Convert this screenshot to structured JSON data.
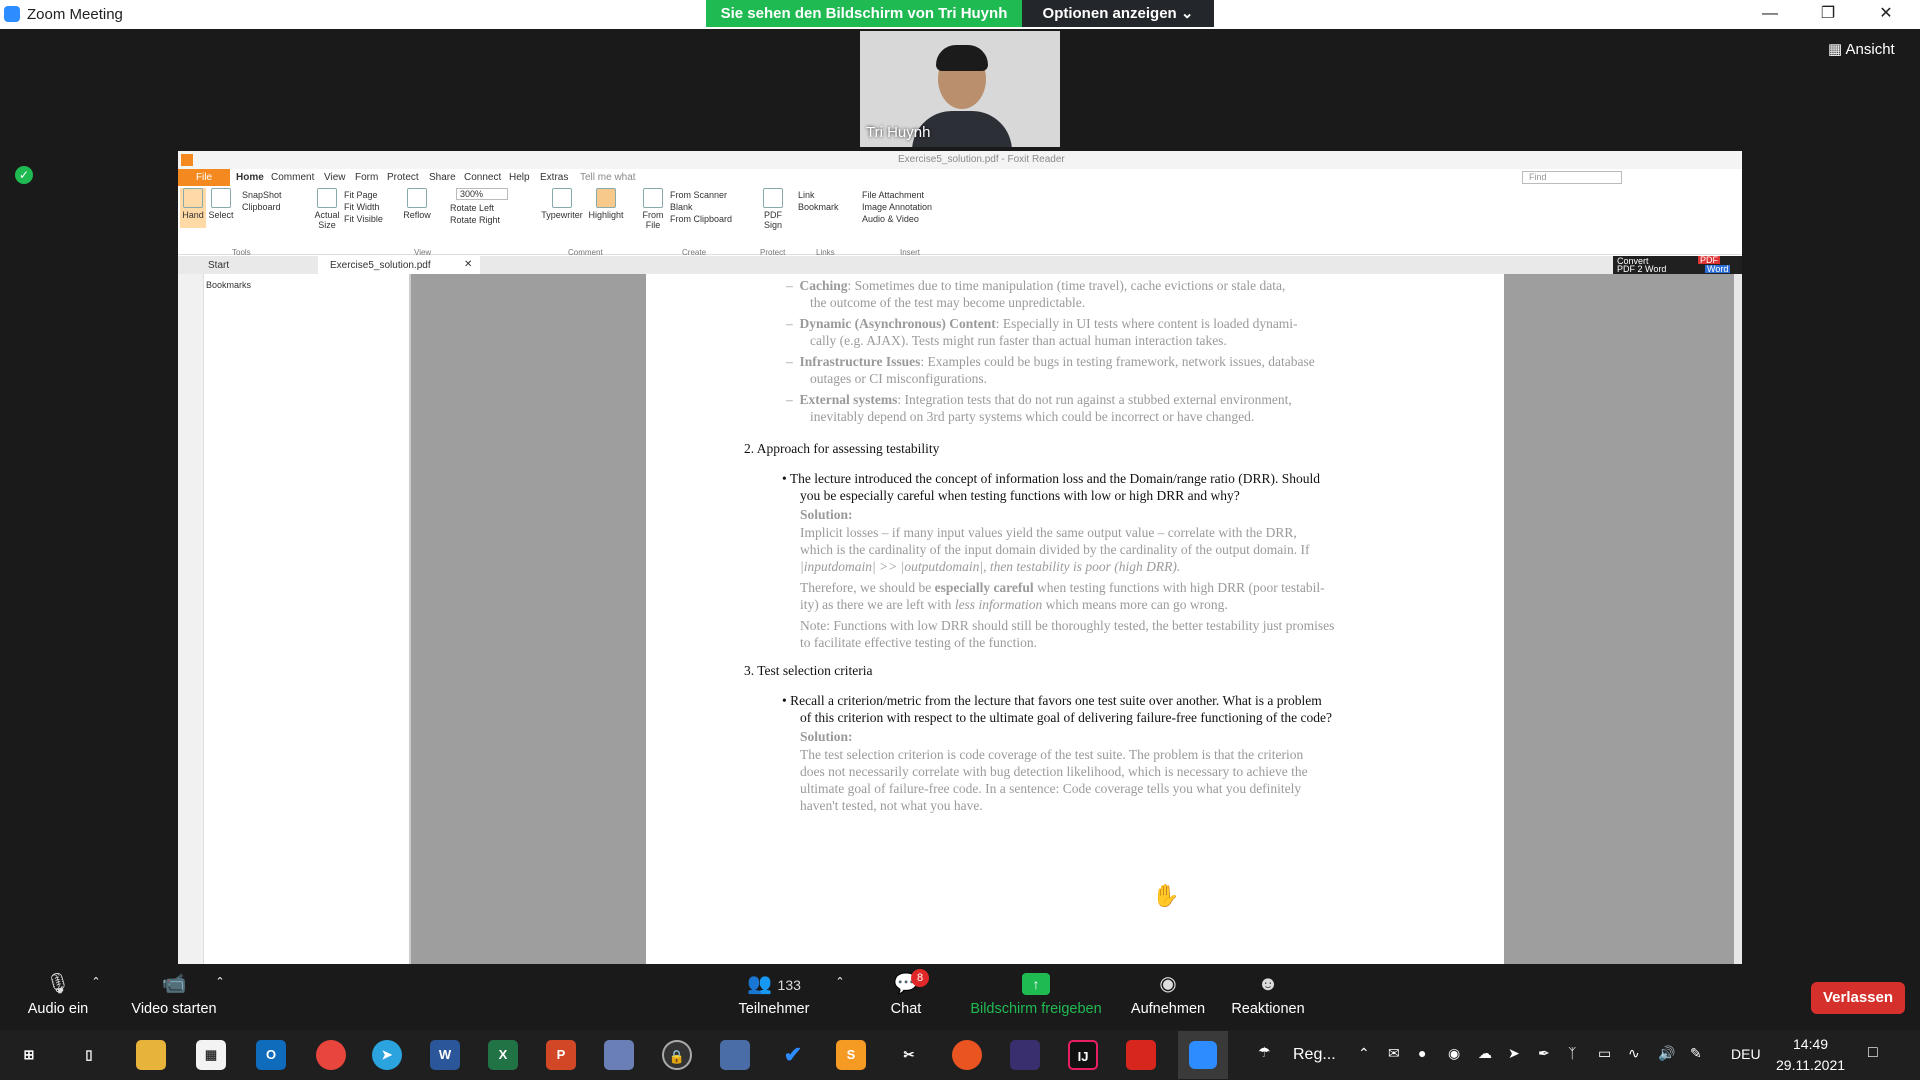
{
  "window": {
    "title": "Zoom Meeting"
  },
  "banner": {
    "viewing": "Sie sehen den Bildschirm von Tri Huynh",
    "options": "Optionen anzeigen ⌄"
  },
  "view_button": "Ansicht",
  "video": {
    "name": "Tri Huynh"
  },
  "reader": {
    "title": "Exercise5_solution.pdf - Foxit Reader",
    "menu": [
      "File",
      "Home",
      "Comment",
      "View",
      "Form",
      "Protect",
      "Share",
      "Connect",
      "Help",
      "Extras",
      "Tell me what"
    ],
    "find_placeholder": "Find",
    "ribbon": {
      "hand": "Hand",
      "select": "Select",
      "snapshot": "SnapShot",
      "clipboard": "Clipboard",
      "tools": "Tools",
      "actual_size": "Actual Size",
      "fit_page": "Fit Page",
      "fit_width": "Fit Width",
      "fit_visible": "Fit Visible",
      "reflow": "Reflow",
      "zoom": "300%",
      "rotate_left": "Rotate Left",
      "rotate_right": "Rotate Right",
      "view": "View",
      "typewriter": "Typewriter",
      "highlight": "Highlight",
      "comment": "Comment",
      "from_file": "From File",
      "from_scanner": "From Scanner",
      "blank": "Blank",
      "from_clipboard": "From Clipboard",
      "create": "Create",
      "pdf_sign": "PDF Sign",
      "protect": "Protect",
      "link": "Link",
      "bookmark": "Bookmark",
      "links": "Links",
      "file_attachment": "File Attachment",
      "image_annotation": "Image Annotation",
      "audio_video": "Audio & Video",
      "insert": "Insert"
    },
    "tabs": {
      "start": "Start",
      "doc": "Exercise5_solution.pdf"
    },
    "convert": {
      "line1": "Convert",
      "line2": "PDF 2 Word",
      "pdf": "PDF",
      "word": "Word"
    },
    "bookmarks_label": "Bookmarks"
  },
  "document": {
    "l1a": "Caching",
    "l1b": ": Sometimes due to time manipulation (time travel), cache evictions or stale data,",
    "l2": "the outcome of the test may become unpredictable.",
    "l3a": "Dynamic (Asynchronous) Content",
    "l3b": ": Especially in UI tests where content is loaded dynami-",
    "l4": "cally (e.g. AJAX). Tests might run faster than actual human interaction takes.",
    "l5a": "Infrastructure Issues",
    "l5b": ": Examples could be bugs in testing framework, network issues, database",
    "l6": "outages or CI misconfigurations.",
    "l7a": "External systems",
    "l7b": ": Integration tests that do not run against a stubbed external environment,",
    "l8": "inevitably depend on 3rd party systems which could be incorrect or have changed.",
    "s2": "2.  Approach for assessing testability",
    "q1": "•  The lecture introduced the concept of information loss and the Domain/range ratio (DRR). Should",
    "q2": "you be especially careful when testing functions with low or high DRR and why?",
    "sol": "Solution:",
    "a1": "Implicit losses – if many input values yield the same output value – correlate with the DRR,",
    "a2": "which is the cardinality of the input domain divided by the cardinality of the output domain.  If",
    "a3": "|inputdomain| >> |outputdomain|, then testability is poor (high DRR).",
    "a4a": "Therefore, we should be ",
    "a4b": "especially careful",
    "a4c": " when testing functions with high DRR (poor testabil-",
    "a5a": "ity) as there we are left with ",
    "a5b": "less information",
    "a5c": " which means more can go wrong.",
    "a6": "Note: Functions with low DRR should still be thoroughly tested, the better testability just promises",
    "a7": "to facilitate effective testing of the function.",
    "s3": "3.  Test selection criteria",
    "r1": "•  Recall a criterion/metric from the lecture that favors one test suite over another. What is a problem",
    "r2": "of this criterion with respect to the ultimate goal of delivering failure-free functioning of the code?",
    "b1": "The test selection criterion is code coverage of the test suite.  The problem is that the criterion",
    "b2": "does not necessarily correlate with bug detection likelihood, which is necessary to achieve the",
    "b3": "ultimate goal of failure-free code.  In a sentence: Code coverage tells you what you definitely",
    "b4": "haven't tested, not what you have."
  },
  "toolbar": {
    "audio": "Audio ein",
    "video": "Video starten",
    "participants": "Teilnehmer",
    "participant_count": "133",
    "chat": "Chat",
    "chat_badge": "8",
    "share": "Bildschirm freigeben",
    "record": "Aufnehmen",
    "reactions": "Reaktionen",
    "leave": "Verlassen"
  },
  "taskbar": {
    "weather": "Reg...",
    "lang": "DEU",
    "time": "14:49",
    "date": "29.11.2021"
  },
  "colors": {
    "green": "#1fba52",
    "zoom_blue": "#2d8cff",
    "leave_red": "#d6302c",
    "foxit_orange": "#f48a1f"
  }
}
